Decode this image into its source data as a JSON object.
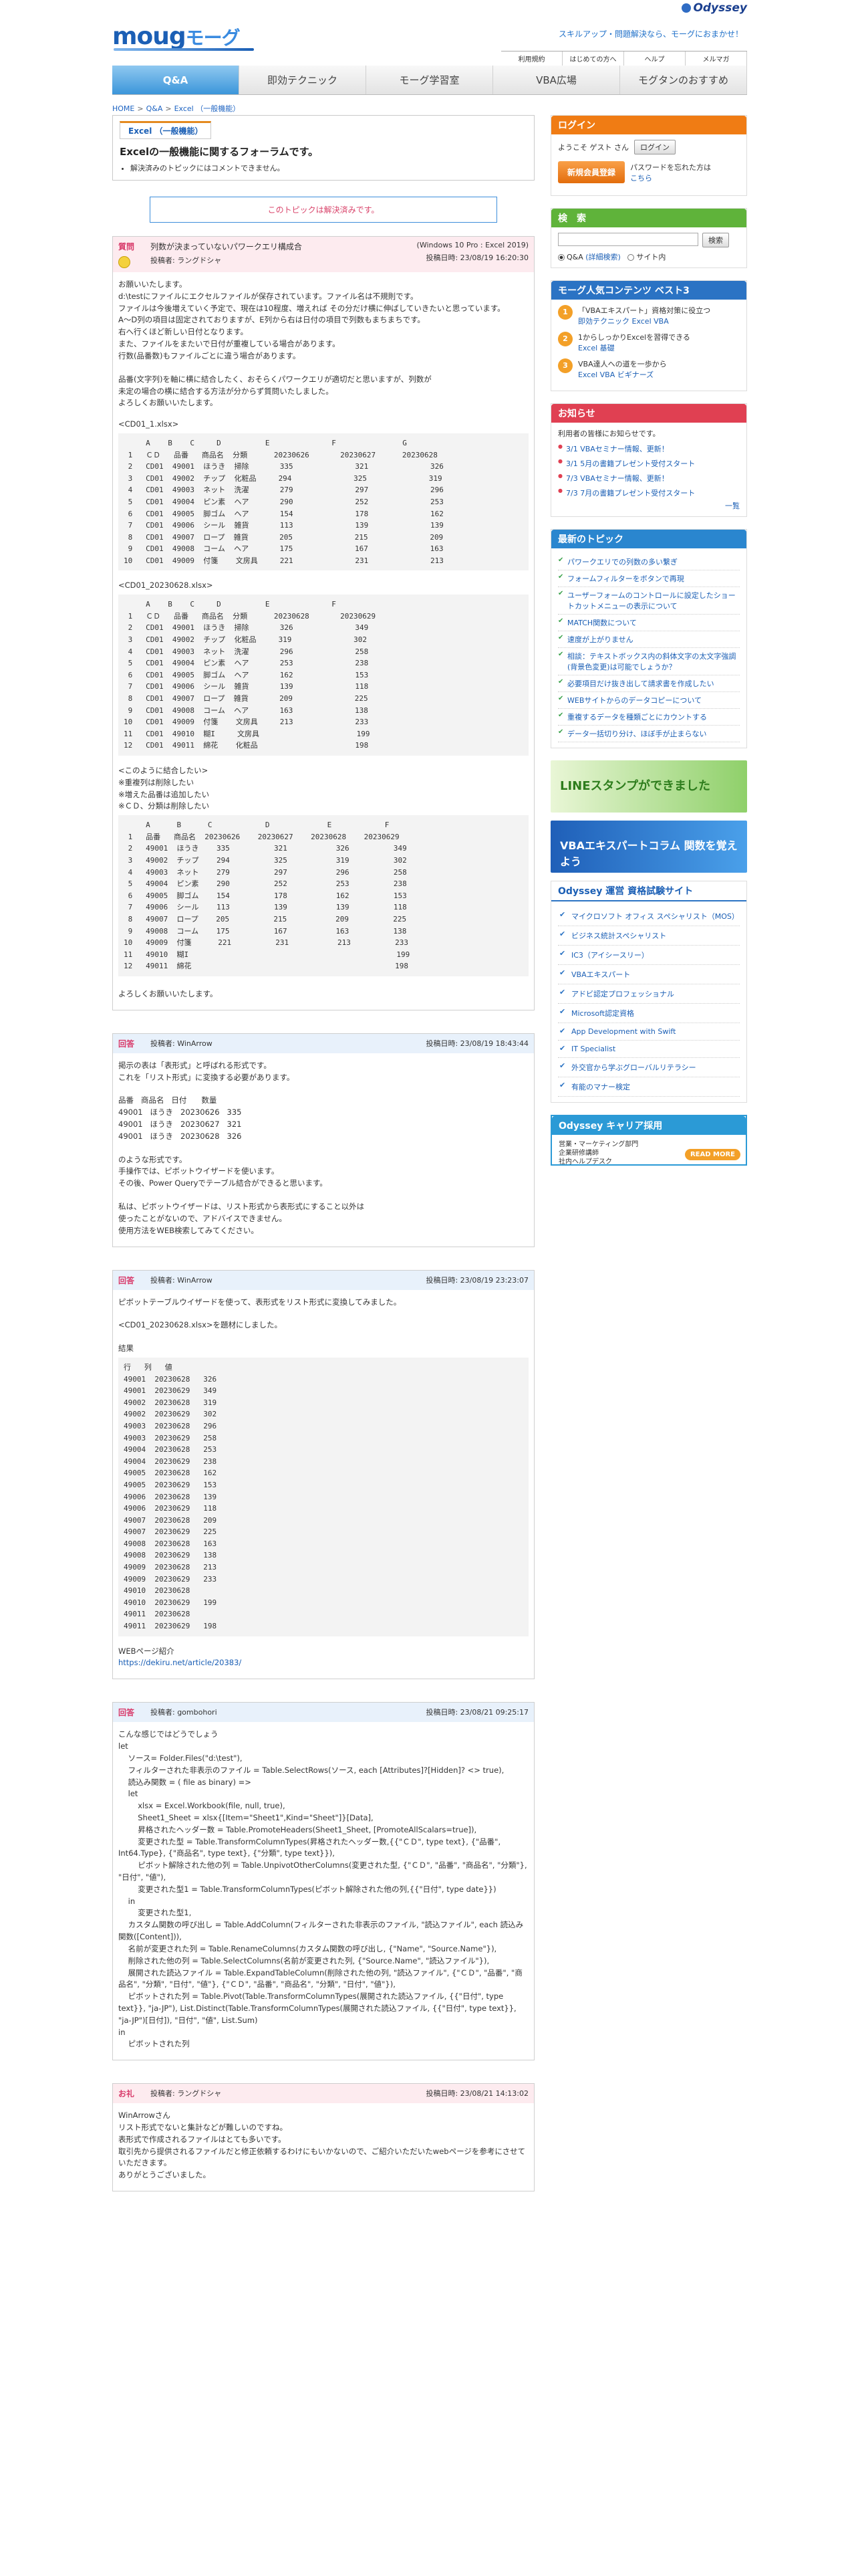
{
  "header": {
    "brand_logo": "Odyssey",
    "site_logo": "moug",
    "site_logo_kana": "モーグ",
    "tagline": "スキルアップ・問題解決なら、モーグにおまかせ！",
    "util_links": [
      "利用規約",
      "はじめての方へ",
      "ヘルプ",
      "メルマガ"
    ]
  },
  "nav": {
    "tabs": [
      "Q&A",
      "即効テクニック",
      "モーグ学習室",
      "VBA広場",
      "モグタンのおすすめ"
    ]
  },
  "breadcrumb": [
    "HOME",
    "Q&A",
    "Excel （一般機能）"
  ],
  "category": {
    "tab": "Excel （一般機能）",
    "title": "Excelの一般機能に関するフォーラムです。",
    "note": "解決済みのトピックにはコメントできません。"
  },
  "solved_notice": "このトピックは解決済みです。",
  "posts": [
    {
      "type": "質問",
      "kind": "q",
      "title": "列数が決まっていないパワークエリ構成合",
      "env": "(Windows 10 Pro : Excel 2019)",
      "poster": "投稿者: ラングドシャ",
      "date": "投稿日時: 23/08/19 16:20:30",
      "body": [
        "お願いいたします。",
        "d:\\testにファイルにエクセルファイルが保存されています。ファイル名は不規則です。",
        "ファイルは今後増えていく予定で、現在は10程度、増えれば その分だけ横に伸ばしていきたいと思っています。",
        "A〜D列の項目は固定されておりますが、E列から右は日付の項目で列数もまちまちです。",
        "右へ行くほど新しい日付となります。",
        "また、ファイルをまたいで日付が重複している場合があります。",
        "行数(品番数)もファイルごとに違う場合があります。",
        "",
        "品番(文字列)を軸に横に結合したく、おそらくパワークエリが適切だと思いますが、列数が",
        "未定の場合の横に結合する方法が分からず質問いたしました。",
        "よろしくお願いいたします。"
      ],
      "blocks": [
        {
          "label": "<CD01_1.xlsx>",
          "text": "     A    B    C     D          E              F               G\n 1   ＣＤ   品番   商品名  分類      20230626       20230627      20230628\n 2   CD01  49001  ほうき  掃除       335              321              326\n 3   CD01  49002  チップ  化粧品     294              325              319\n 4   CD01  49003  ネット  洗濯       279              297              296\n 5   CD01  49004  ピン素  ヘア       290              252              253\n 6   CD01  49005  脚ゴム  ヘア       154              178              162\n 7   CD01  49006  シール  雑貨       113              139              139\n 8   CD01  49007  ロープ  雑貨       205              215              209\n 9   CD01  49008  コーム  ヘア       175              167              163\n10   CD01  49009  付箋    文房具     221              231              213"
        },
        {
          "label": "<CD01_20230628.xlsx>",
          "text": "     A    B    C     D          E              F\n 1   ＣＤ   品番   商品名  分類      20230628       20230629\n 2   CD01  49001  ほうき  掃除       326              349\n 3   CD01  49002  チップ  化粧品     319              302\n 4   CD01  49003  ネット  洗濯       296              258\n 5   CD01  49004  ピン素  ヘア       253              238\n 6   CD01  49005  脚ゴム  ヘア       162              153\n 7   CD01  49006  シール  雑貨       139              118\n 8   CD01  49007  ロープ  雑貨       209              225\n 9   CD01  49008  コーム  ヘア       163              138\n10   CD01  49009  付箋    文房具     213              233\n11   CD01  49010  糊I     文房具                      199\n12   CD01  49011  綿花    化粧品                      198"
        },
        {
          "label": "<このように結合したい>\n※重複列は削除したい\n※増えた品番は追加したい\n※ＣＤ、分類は削除したい",
          "text": "     A      B      C            D             E            F\n 1   品番   商品名  20230626    20230627    20230628    20230629\n 2   49001  ほうき    335          321           326          349\n 3   49002  チップ    294          325           319          302\n 4   49003  ネット    279          297           296          258\n 5   49004  ピン素    290          252           253          238\n 6   49005  脚ゴム    154          178           162          153\n 7   49006  シール    113          139           139          118\n 8   49007  ロープ    205          215           209          225\n 9   49008  コーム    175          167           163          138\n10   49009  付箋      221          231           213          233\n11   49010  糊I                                               199\n12   49011  綿花                                              198"
        }
      ],
      "closing": "よろしくお願いいたします。"
    },
    {
      "type": "回答",
      "kind": "a",
      "title": "",
      "env": "",
      "poster": "投稿者: WinArrow",
      "date": "投稿日時: 23/08/19 18:43:44",
      "body": [
        "掲示の表は「表形式」と呼ばれる形式です。",
        "これを「リスト形式」に変換する必要があります。",
        "",
        "品番   商品名   日付      数量",
        "49001   ほうき   20230626   335",
        "49001   ほうき   20230627   321",
        "49001   ほうき   20230628   326",
        "",
        "のような形式です。",
        "手操作では、ピボットウイザードを使います。",
        "その後、Power Queryでテーブル結合ができると思います。",
        "",
        "私は、ピボットウイザードは、リスト形式から表形式にすること以外は",
        "使ったことがないので、アドバイスできません。",
        "使用方法をWEB検索してみてください。"
      ]
    },
    {
      "type": "回答",
      "kind": "a",
      "title": "",
      "env": "",
      "poster": "投稿者: WinArrow",
      "date": "投稿日時: 23/08/19 23:23:07",
      "body": [
        "ピボットテーブルウイザードを使って、表形式をリスト形式に変換してみました。",
        "",
        "<CD01_20230628.xlsx>を題材にしました。",
        "",
        "結果"
      ],
      "result": "行   列   値\n49001  20230628   326\n49001  20230629   349\n49002  20230628   319\n49002  20230629   302\n49003  20230628   296\n49003  20230629   258\n49004  20230628   253\n49004  20230629   238\n49005  20230628   162\n49005  20230629   153\n49006  20230628   139\n49006  20230629   118\n49007  20230628   209\n49007  20230629   225\n49008  20230628   163\n49008  20230629   138\n49009  20230628   213\n49009  20230629   233\n49010  20230628\n49010  20230629   199\n49011  20230628\n49011  20230629   198",
      "ref_label": "WEBページ紹介",
      "ref_link": "https://dekiru.net/article/20383/"
    },
    {
      "type": "回答",
      "kind": "a",
      "title": "",
      "env": "",
      "poster": "投稿者: gombohori",
      "date": "投稿日時: 23/08/21 09:25:17",
      "body": [
        "こんな感じではどうでしょう",
        "let",
        "    ソース= Folder.Files(\"d:\\test\"),",
        "    フィルターされた非表示のファイル = Table.SelectRows(ソース, each [Attributes]?[Hidden]? <> true),",
        "    読込み関数 = ( file as binary) =>",
        "    let",
        "        xlsx = Excel.Workbook(file, null, true),",
        "        Sheet1_Sheet = xlsx{[Item=\"Sheet1\",Kind=\"Sheet\"]}[Data],",
        "        昇格されたヘッダー数 = Table.PromoteHeaders(Sheet1_Sheet, [PromoteAllScalars=true]),",
        "        変更された型 = Table.TransformColumnTypes(昇格されたヘッダー数,{{\"ＣＤ\", type text}, {\"品番\", Int64.Type}, {\"商品名\", type text}, {\"分類\", type text}}),",
        "        ピボット解除された他の列 = Table.UnpivotOtherColumns(変更された型, {\"ＣＤ\", \"品番\", \"商品名\", \"分類\"}, \"日付\", \"値\"),",
        "        変更された型1 = Table.TransformColumnTypes(ピボット解除された他の列,{{\"日付\", type date}})",
        "    in",
        "        変更された型1,",
        "    カスタム関数の呼び出し = Table.AddColumn(フィルターされた非表示のファイル, \"読込ファイル\", each 読込み関数([Content])),",
        "    名前が変更された列 = Table.RenameColumns(カスタム関数の呼び出し, {\"Name\", \"Source.Name\"}),",
        "    削除された他の列 = Table.SelectColumns(名前が変更された列, {\"Source.Name\", \"読込ファイル\"}),",
        "    展開された読込ファイル = Table.ExpandTableColumn(削除された他の列, \"読込ファイル\", {\"ＣＤ\", \"品番\", \"商品名\", \"分類\", \"日付\", \"値\"}, {\"ＣＤ\", \"品番\", \"商品名\", \"分類\", \"日付\", \"値\"}),",
        "    ピボットされた列 = Table.Pivot(Table.TransformColumnTypes(展開された読込ファイル, {{\"日付\", type text}}, \"ja-JP\"), List.Distinct(Table.TransformColumnTypes(展開された読込ファイル, {{\"日付\", type text}}, \"ja-JP\")[日付]), \"日付\", \"値\", List.Sum)",
        "in",
        "    ピボットされた列"
      ]
    },
    {
      "type": "お礼",
      "kind": "t",
      "title": "",
      "env": "",
      "poster": "投稿者: ラングドシャ",
      "date": "投稿日時: 23/08/21 14:13:02",
      "body": [
        "WinArrowさん",
        "リスト形式でないと集計などが難しいのですね。",
        "表形式で作成されるファイルはとても多いです。",
        "取引先から提供されるファイルだと修正依頼するわけにもいかないので、ご紹介いただいたwebページを参考にさせていただきます。",
        "ありがとうございました。"
      ]
    }
  ],
  "sidebar": {
    "login": {
      "title": "ログイン",
      "greeting": "ようこそ ゲスト さん",
      "login_btn": "ログイン",
      "register_btn": "新規会員登録",
      "forgot": "パスワードを忘れた方は",
      "forgot_link": "こちら"
    },
    "search": {
      "title": "検　索",
      "button": "検索",
      "opt1": "Q&A",
      "opt1_note": "(詳細検索)",
      "opt2": "サイト内"
    },
    "ranking": {
      "title": "モーグ人気コンテンツ ベスト3",
      "items": [
        {
          "rank": "1",
          "text": "「VBAエキスパート」資格対策に役立つ",
          "link": "即効テクニック Excel VBA"
        },
        {
          "rank": "2",
          "text": "1からしっかりExcelを習得できる",
          "link": "Excel 基礎"
        },
        {
          "rank": "3",
          "text": "VBA達人への道を一歩から",
          "link": "Excel VBA ビギナーズ"
        }
      ]
    },
    "news": {
      "title": "お知らせ",
      "intro": "利用者の皆様にお知らせです。",
      "items": [
        "3/1 VBAセミナー情報、更新！",
        "3/1 5月の書籍プレゼント受付スタート",
        "7/3 VBAセミナー情報、更新！",
        "7/3 7月の書籍プレゼント受付スタート"
      ],
      "more": "一覧"
    },
    "topics": {
      "title": "最新のトピック",
      "items": [
        "パワークエリでの列数の多い繋ぎ",
        "フォームフィルターをボタンで再現",
        "ユーザーフォームのコントロールに設定したショートカットメニューの表示について",
        "MATCH関数について",
        "速度が上がりません",
        "相談：テキストボックス内の斜体文字の太文字強調(背景色変更)は可能でしょうか？",
        "必要項目だけ抜き出して請求書を作成したい",
        "WEBサイトからのデータコピーについて",
        "重複するデータを種類ごとにカウントする",
        "データ一括切り分け、ほぼ手が止まらない"
      ]
    },
    "banner1": "LINEスタンプができました",
    "banner2": "VBAエキスパートコラム 関数を覚えよう",
    "exam": {
      "title": "Odyssey 運営 資格試験サイト",
      "items": [
        "マイクロソフト オフィス スペシャリスト（MOS）",
        "ビジネス統計スペシャリスト",
        "IC3（アイシースリー）",
        "VBAエキスパート",
        "アドビ認定プロフェッショナル",
        "Microsoft認定資格",
        "App Development with Swift",
        "IT Specialist",
        "外交官から学ぶグローバルリテラシー",
        "有能のマナー検定"
      ]
    },
    "career": {
      "title": "Odyssey キャリア採用",
      "lines": [
        "営業・マーケティング部門",
        "企業研修講師",
        "社内ヘルプデスク"
      ],
      "button": "READ MORE"
    }
  }
}
